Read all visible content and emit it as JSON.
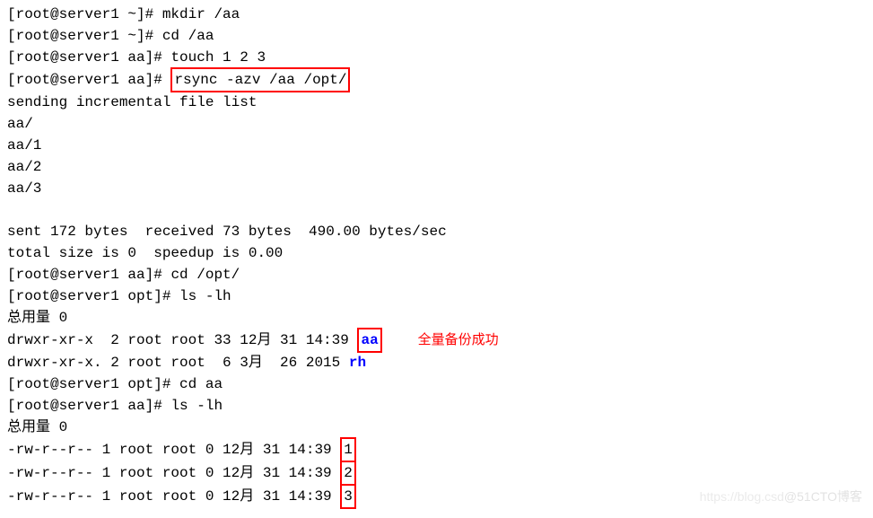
{
  "lines": {
    "l1_prompt": "[root@server1 ~]# ",
    "l1_cmd": "mkdir /aa",
    "l2_prompt": "[root@server1 ~]# ",
    "l2_cmd": "cd /aa",
    "l3_prompt": "[root@server1 aa]# ",
    "l3_cmd": "touch 1 2 3",
    "l4_prompt": "[root@server1 aa]# ",
    "l4_cmd": "rsync -azv /aa /opt/",
    "l5": "sending incremental file list",
    "l6": "aa/",
    "l7": "aa/1",
    "l8": "aa/2",
    "l9": "aa/3",
    "l10": "sent 172 bytes  received 73 bytes  490.00 bytes/sec",
    "l11": "total size is 0  speedup is 0.00",
    "l12_prompt": "[root@server1 aa]# ",
    "l12_cmd": "cd /opt/",
    "l13_prompt": "[root@server1 opt]# ",
    "l13_cmd": "ls -lh",
    "l14": "总用量 0",
    "l15_pre": "drwxr-xr-x  2 root root 33 12月 31 14:39 ",
    "l15_name": "aa",
    "l15_annotation": "全量备份成功",
    "l16_pre": "drwxr-xr-x. 2 root root  6 3月  26 2015 ",
    "l16_name": "rh",
    "l17_prompt": "[root@server1 opt]# ",
    "l17_cmd": "cd aa",
    "l18_prompt": "[root@server1 aa]# ",
    "l18_cmd": "ls -lh",
    "l19": "总用量 0",
    "l20_pre": "-rw-r--r-- 1 root root 0 12月 31 14:39 ",
    "l20_name": "1",
    "l21_pre": "-rw-r--r-- 1 root root 0 12月 31 14:39 ",
    "l21_name": "2",
    "l22_pre": "-rw-r--r-- 1 root root 0 12月 31 14:39 ",
    "l22_name": "3"
  },
  "watermark": {
    "w1": "https://blog.csd",
    "w2": "@51CTO博客"
  }
}
